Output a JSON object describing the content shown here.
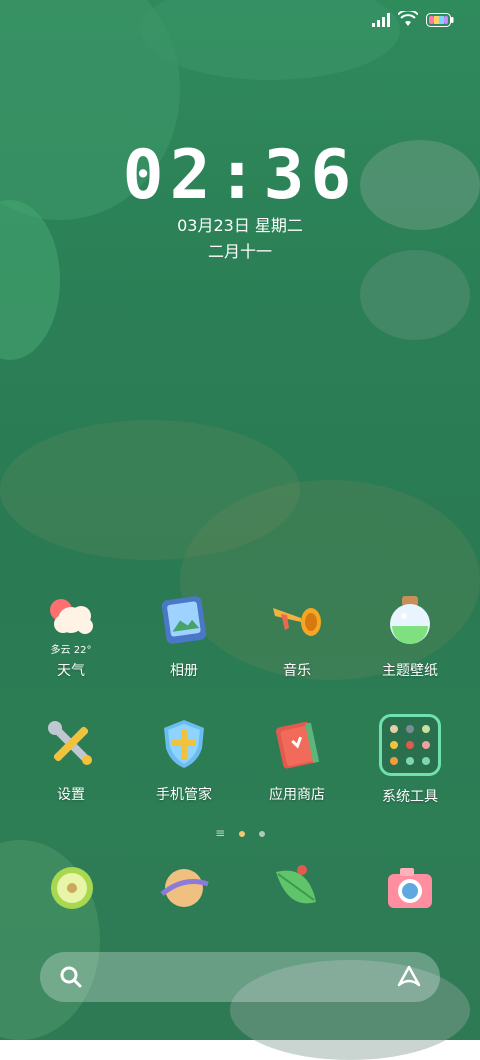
{
  "status_bar": {
    "signal_icon": "cellular-signal-icon",
    "wifi_icon": "wifi-icon",
    "battery_icon": "battery-icon"
  },
  "lockclock": {
    "time": "02:36",
    "date": "03月23日 星期二",
    "lunar": "二月十一"
  },
  "apps": {
    "row1": [
      {
        "label": "天气",
        "icon": "weather-icon",
        "sub": "多云 22°"
      },
      {
        "label": "相册",
        "icon": "gallery-icon"
      },
      {
        "label": "音乐",
        "icon": "music-icon"
      },
      {
        "label": "主题壁纸",
        "icon": "themes-icon"
      }
    ],
    "row2": [
      {
        "label": "设置",
        "icon": "settings-icon"
      },
      {
        "label": "手机管家",
        "icon": "security-icon"
      },
      {
        "label": "应用商店",
        "icon": "app-store-icon"
      },
      {
        "label": "系统工具",
        "icon": "system-tools-folder-icon"
      }
    ]
  },
  "page_indicator": {
    "pages": 3,
    "current": 1
  },
  "dock": {
    "apps": [
      "phone-icon",
      "browser-icon",
      "messages-icon",
      "camera-icon"
    ]
  },
  "search_bar": {
    "search_icon": "search-icon",
    "assistant_icon": "assistant-icon"
  },
  "colors": {
    "wallpaper_green": "#2b7f56",
    "text": "#ffffff"
  }
}
